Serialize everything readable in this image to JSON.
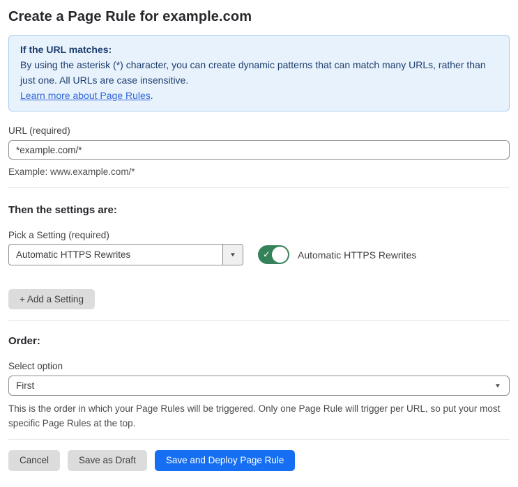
{
  "page": {
    "title": "Create a Page Rule for example.com"
  },
  "info_box": {
    "heading": "If the URL matches:",
    "body": "By using the asterisk (*) character, you can create dynamic patterns that can match many URLs, rather than just one. All URLs are case insensitive.",
    "link_label": "Learn more about Page Rules",
    "link_suffix": "."
  },
  "url_field": {
    "label": "URL (required)",
    "value": "*example.com/*",
    "helper": "Example: www.example.com/*"
  },
  "settings_section": {
    "heading": "Then the settings are:",
    "picker_label": "Pick a Setting (required)",
    "picker_value": "Automatic HTTPS Rewrites",
    "toggle_state": "on",
    "toggle_label": "Automatic HTTPS Rewrites",
    "add_setting_label": "+ Add a Setting"
  },
  "order_section": {
    "heading": "Order:",
    "select_label": "Select option",
    "select_value": "First",
    "helper": "This is the order in which your Page Rules will be triggered. Only one Page Rule will trigger per URL, so put your most specific Page Rules at the top."
  },
  "footer": {
    "cancel_label": "Cancel",
    "save_draft_label": "Save as Draft",
    "save_deploy_label": "Save and Deploy Page Rule"
  },
  "colors": {
    "info_bg": "#e8f2fc",
    "info_border": "#a9cdee",
    "info_text": "#1c3d6e",
    "link_blue": "#2f67d8",
    "toggle_green": "#35825a",
    "primary_blue": "#166ff2",
    "button_gray": "#dcdcdc"
  },
  "icons": {
    "dropdown_arrow": "▼",
    "checkmark": "✓"
  }
}
